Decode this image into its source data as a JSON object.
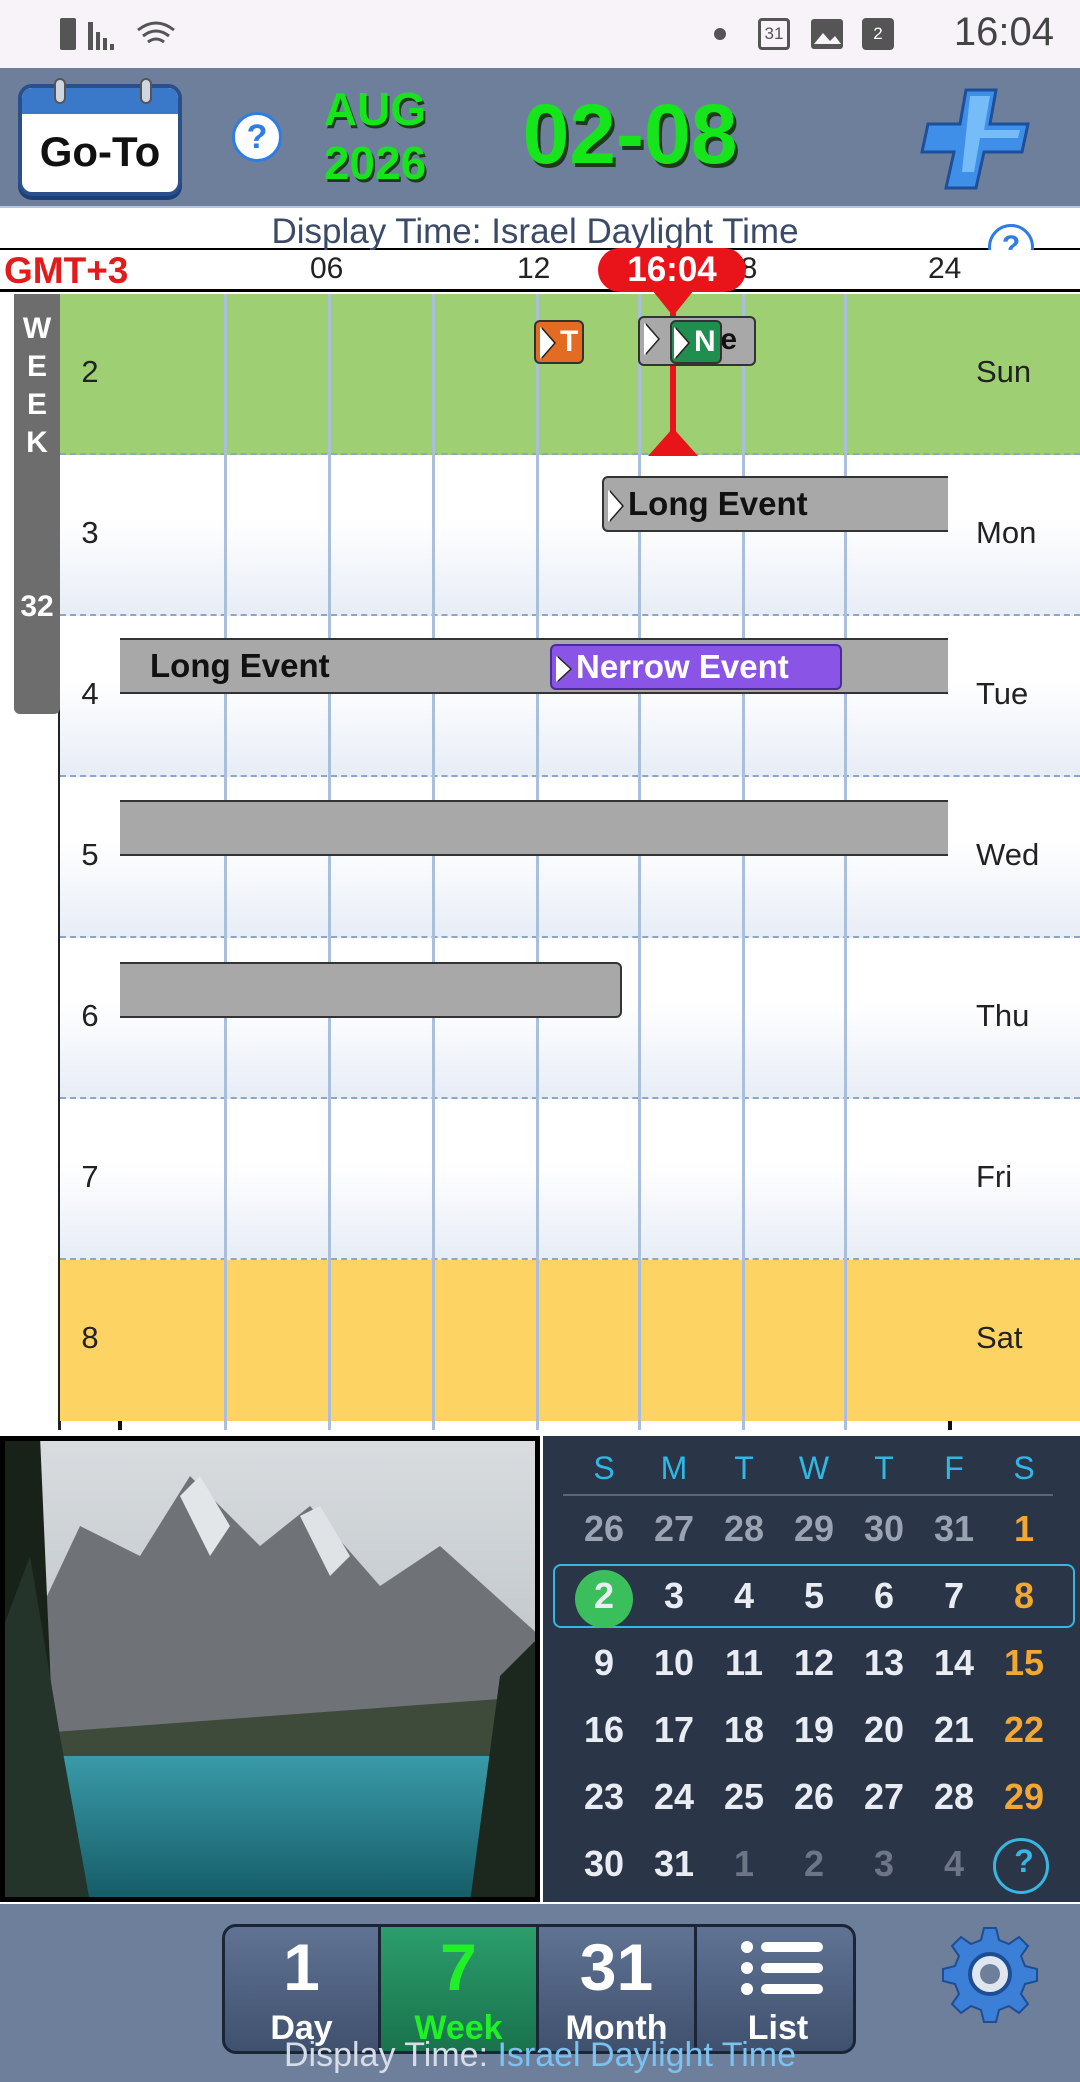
{
  "status_bar": {
    "time": "16:04",
    "calendar_badge_1": "31",
    "calendar_badge_2": "2"
  },
  "header": {
    "goto_label": "Go-To",
    "help_label": "?",
    "month": "AUG",
    "year": "2026",
    "date_range": "02-08",
    "add_icon": "plus-icon"
  },
  "display_time": {
    "label": "Display Time: Israel Daylight Time",
    "help_label": "?"
  },
  "axis": {
    "gmt": "GMT+3",
    "ticks": [
      "06",
      "12",
      "18",
      "24"
    ],
    "now": "16:04"
  },
  "week": {
    "letters": "W E E K",
    "number": "32"
  },
  "rows": [
    {
      "num": "2",
      "day": "Sun",
      "bg": "#9ecf73"
    },
    {
      "num": "3",
      "day": "Mon",
      "bg": "#ffffff"
    },
    {
      "num": "4",
      "day": "Tue",
      "bg": "#ffffff"
    },
    {
      "num": "5",
      "day": "Wed",
      "bg": "#ffffff"
    },
    {
      "num": "6",
      "day": "Thu",
      "bg": "#ffffff"
    },
    {
      "num": "7",
      "day": "Fri",
      "bg": "#ffffff"
    },
    {
      "num": "8",
      "day": "Sat",
      "bg": "#fdd364"
    }
  ],
  "events": {
    "sun_chip_1": "T",
    "sun_chip_2": "le",
    "sun_chip_3": "N",
    "mon_long": "Long Event",
    "tue_long": "Long Event",
    "tue_narrow": "Nerrow Event"
  },
  "mini_calendar": {
    "headers": [
      "S",
      "M",
      "T",
      "W",
      "T",
      "F",
      "S"
    ],
    "weeks": [
      [
        "26",
        "27",
        "28",
        "29",
        "30",
        "31",
        "1"
      ],
      [
        "2",
        "3",
        "4",
        "5",
        "6",
        "7",
        "8"
      ],
      [
        "9",
        "10",
        "11",
        "12",
        "13",
        "14",
        "15"
      ],
      [
        "16",
        "17",
        "18",
        "19",
        "20",
        "21",
        "22"
      ],
      [
        "23",
        "24",
        "25",
        "26",
        "27",
        "28",
        "29"
      ],
      [
        "30",
        "31",
        "1",
        "2",
        "3",
        "4",
        "?"
      ]
    ],
    "today": "2"
  },
  "tabs": [
    {
      "big": "1",
      "small": "Day"
    },
    {
      "big": "7",
      "small": "Week"
    },
    {
      "big": "31",
      "small": "Month"
    },
    {
      "big": "",
      "small": "List"
    }
  ],
  "footer": {
    "prefix": "Display Time: ",
    "timezone": "Israel Daylight Time"
  },
  "colors": {
    "accent_green": "#16e51c",
    "now_red": "#e8141a",
    "header_bg": "#6e7f9b",
    "narrow_event": "#8a55e6"
  }
}
